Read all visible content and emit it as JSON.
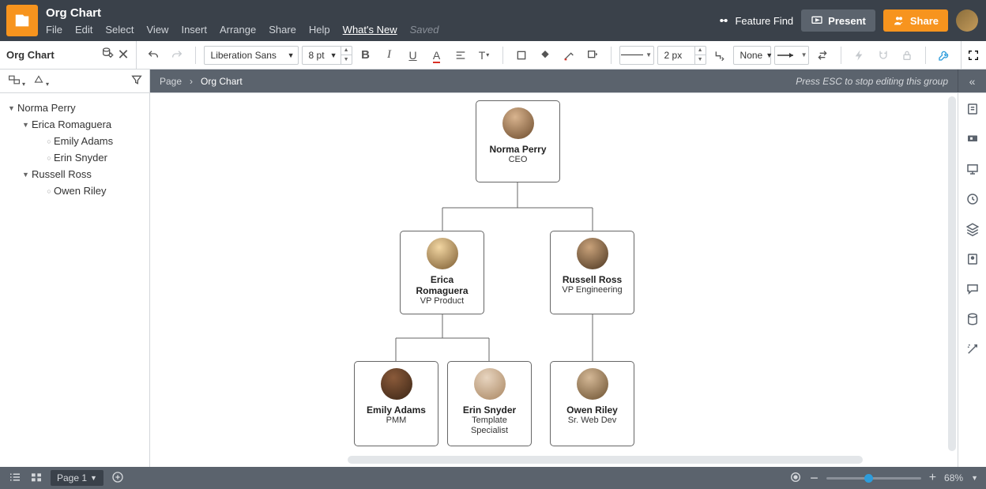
{
  "header": {
    "doc_title": "Org Chart",
    "menu": [
      "File",
      "Edit",
      "Select",
      "View",
      "Insert",
      "Arrange",
      "Share",
      "Help",
      "What's New"
    ],
    "saved": "Saved",
    "feature_find": "Feature Find",
    "present": "Present",
    "share": "Share"
  },
  "toolbar": {
    "panel_title": "Org Chart",
    "font_family": "Liberation Sans",
    "font_size": "8 pt",
    "line_width": "2 px",
    "arrow_start": "None"
  },
  "breadcrumb": {
    "root": "Page",
    "current": "Org Chart"
  },
  "esc_hint": "Press ESC to stop editing this group",
  "tree": [
    {
      "depth": 0,
      "caret": true,
      "label": "Norma Perry"
    },
    {
      "depth": 1,
      "caret": true,
      "label": "Erica Romaguera"
    },
    {
      "depth": 2,
      "caret": false,
      "label": "Emily Adams"
    },
    {
      "depth": 2,
      "caret": false,
      "label": "Erin Snyder"
    },
    {
      "depth": 1,
      "caret": true,
      "label": "Russell Ross"
    },
    {
      "depth": 2,
      "caret": false,
      "label": "Owen Riley"
    }
  ],
  "nodes": {
    "ceo": {
      "name": "Norma Perry",
      "role": "CEO",
      "avatar_bg": "radial-gradient(circle at 40% 30%, #d9b48f, #6b4a2b)"
    },
    "vp1": {
      "name": "Erica Romaguera",
      "role": "VP Product",
      "avatar_bg": "radial-gradient(circle at 40% 30%, #f2d6a2, #7a5a30)"
    },
    "vp2": {
      "name": "Russell Ross",
      "role": "VP Engineering",
      "avatar_bg": "radial-gradient(circle at 40% 30%, #c9a27a, #4a3520)"
    },
    "r1": {
      "name": "Emily Adams",
      "role": "PMM",
      "avatar_bg": "radial-gradient(circle at 40% 30%, #8a5a3a, #3a2515)"
    },
    "r2": {
      "name": "Erin Snyder",
      "role": "Template Specialist",
      "avatar_bg": "radial-gradient(circle at 40% 30%, #e8d5c0, #a88560)"
    },
    "r3": {
      "name": "Owen Riley",
      "role": "Sr. Web Dev",
      "avatar_bg": "radial-gradient(circle at 40% 30%, #d4b896, #6b5030)"
    }
  },
  "footer": {
    "page_label": "Page 1",
    "zoom": "68%"
  }
}
